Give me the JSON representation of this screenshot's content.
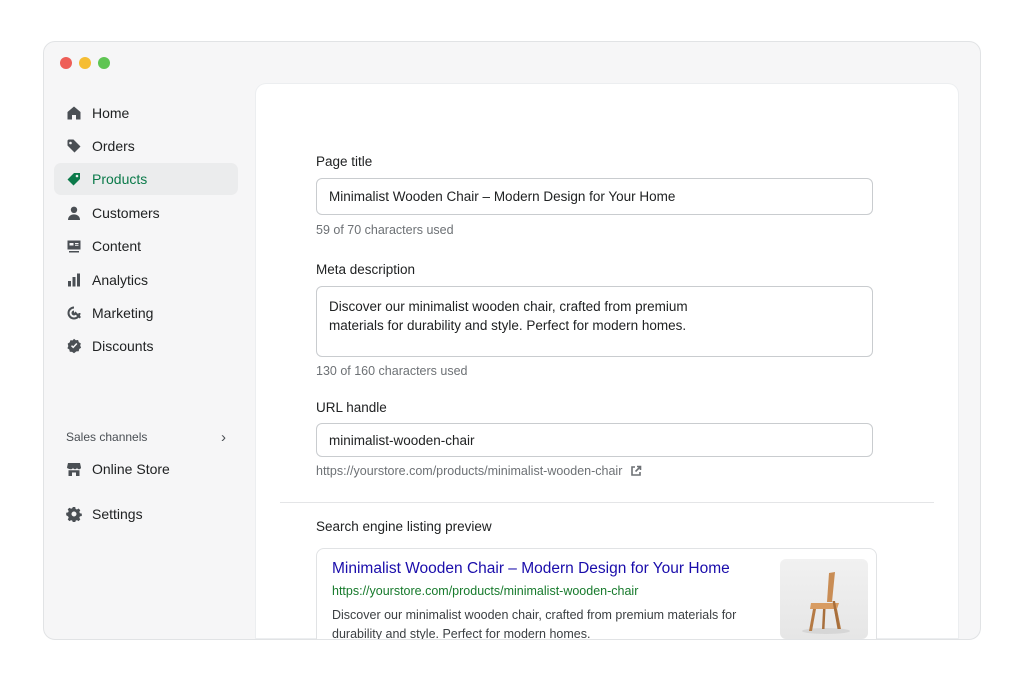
{
  "window": {
    "controls": [
      "close",
      "minimize",
      "maximize"
    ]
  },
  "sidebar": {
    "items": [
      {
        "label": "Home",
        "icon": "home-icon"
      },
      {
        "label": "Orders",
        "icon": "tag-icon"
      },
      {
        "label": "Products",
        "icon": "product-tag-icon",
        "active": true
      },
      {
        "label": "Customers",
        "icon": "person-icon"
      },
      {
        "label": "Content",
        "icon": "content-icon"
      },
      {
        "label": "Analytics",
        "icon": "bar-chart-icon"
      },
      {
        "label": "Marketing",
        "icon": "target-icon"
      },
      {
        "label": "Discounts",
        "icon": "badge-check-icon"
      }
    ],
    "sales_channels": {
      "label": "Sales channels",
      "chevron": "›",
      "items": [
        {
          "label": "Online Store",
          "icon": "store-icon"
        }
      ]
    },
    "settings": {
      "label": "Settings",
      "icon": "gear-icon"
    }
  },
  "seo": {
    "page_title": {
      "label": "Page title",
      "value": "Minimalist Wooden Chair – Modern Design for Your Home",
      "help": "59 of 70 characters used"
    },
    "meta_description": {
      "label": "Meta description",
      "value": "Discover our minimalist wooden chair, crafted from premium\nmaterials for durability and style. Perfect for modern homes.",
      "help": "130 of 160 characters used"
    },
    "url_handle": {
      "label": "URL handle",
      "value": "minimalist-wooden-chair",
      "full_url": "https://yourstore.com/products/minimalist-wooden-chair"
    },
    "preview": {
      "label": "Search engine listing preview",
      "title": "Minimalist Wooden Chair – Modern Design for Your Home",
      "url": "https://yourstore.com/products/minimalist-wooden-chair",
      "description": "Discover our minimalist wooden chair, crafted from premium materials for durability and style. Perfect for modern homes."
    }
  },
  "colors": {
    "accent": "#0b7a4a",
    "link": "#1a0dab",
    "url_green": "#177a2c"
  }
}
